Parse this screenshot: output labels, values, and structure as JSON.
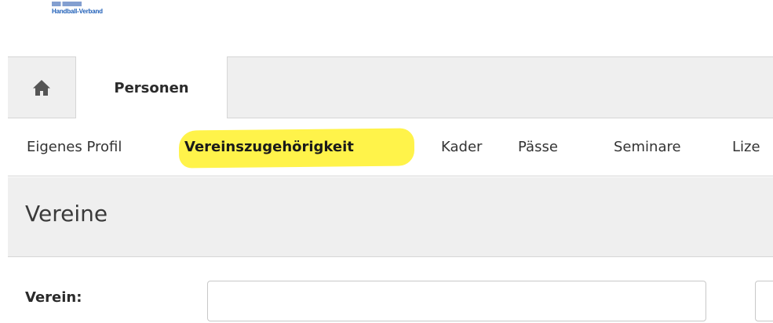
{
  "logo": {
    "line2": "Handball-Verband"
  },
  "tabs": {
    "home_icon": "home-icon",
    "items": [
      {
        "label": "Personen",
        "active": true
      }
    ]
  },
  "subnav": {
    "items": [
      {
        "label": "Eigenes Profil",
        "active": false
      },
      {
        "label": "Vereinszugehörigkeit",
        "active": true,
        "highlighted": true
      },
      {
        "label": "Kader",
        "active": false
      },
      {
        "label": "Pässe",
        "active": false
      },
      {
        "label": "Seminare",
        "active": false
      },
      {
        "label": "Lize",
        "active": false
      }
    ]
  },
  "section": {
    "title": "Vereine"
  },
  "form": {
    "verein_label": "Verein:",
    "verein_value": "",
    "second_value": ""
  },
  "colors": {
    "highlight": "#fff34a",
    "logo_blue": "#1f5fb8",
    "bar_gray": "#efefef"
  }
}
